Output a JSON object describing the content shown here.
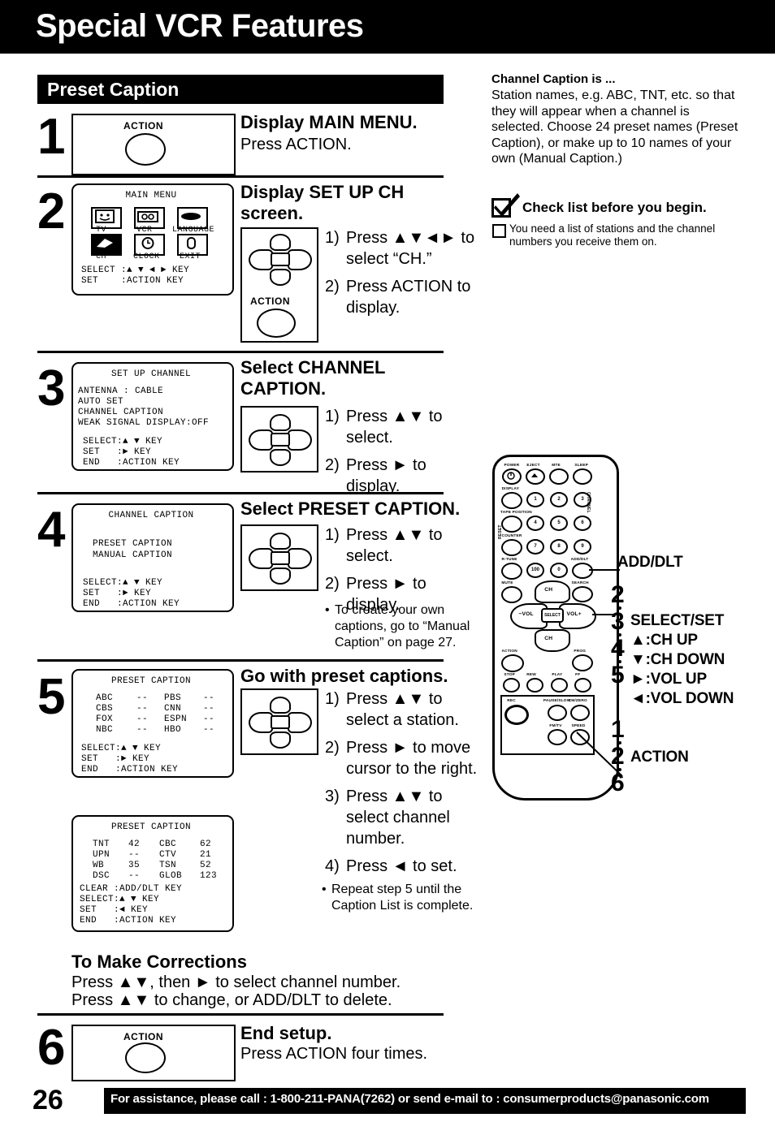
{
  "header": {
    "title": "Special VCR Features"
  },
  "section": {
    "bar_title": "Preset Caption"
  },
  "steps": [
    {
      "num": "1",
      "title": "Display MAIN MENU.",
      "body": "Press ACTION.",
      "action_label": "ACTION"
    },
    {
      "num": "2",
      "title_line1": "Display SET UP CH",
      "title_line2": "screen.",
      "action_label": "ACTION",
      "osd": {
        "title": "MAIN MENU",
        "icons": [
          {
            "label": "TV",
            "icon": "tv-icon",
            "selected": false
          },
          {
            "label": "VCR",
            "icon": "vcr-icon",
            "selected": false
          },
          {
            "label": "LANGUAGE",
            "icon": "language-icon",
            "selected": false
          },
          {
            "label": "CH",
            "icon": "ch-icon",
            "selected": true
          },
          {
            "label": "CLOCK",
            "icon": "clock-icon",
            "selected": false
          },
          {
            "label": "EXIT",
            "icon": "exit-icon",
            "selected": false
          }
        ],
        "footer": "SELECT :▲ ▼ ◄ ► KEY\nSET    :ACTION KEY"
      },
      "instructions": [
        {
          "n": "1)",
          "text": "Press ▲▼◄► to select “CH.”"
        },
        {
          "n": "2)",
          "text": "Press ACTION to display."
        }
      ]
    },
    {
      "num": "3",
      "title_line1": "Select CHANNEL",
      "title_line2": "CAPTION.",
      "osd": {
        "title": "SET UP CHANNEL",
        "lines": [
          {
            "text": "ANTENNA : CABLE",
            "hl": false
          },
          {
            "text": "AUTO SET",
            "hl": false
          },
          {
            "text": "CHANNEL CAPTION",
            "hl": true
          },
          {
            "text": "WEAK SIGNAL DISPLAY:OFF",
            "hl": false
          }
        ],
        "footer": "SELECT:▲ ▼ KEY\nSET   :► KEY\nEND   :ACTION KEY"
      },
      "instructions": [
        {
          "n": "1)",
          "text": "Press ▲▼ to select."
        },
        {
          "n": "2)",
          "text": "Press ► to display."
        }
      ]
    },
    {
      "num": "4",
      "title_line1": "Select PRESET CAPTION.",
      "osd": {
        "title": "CHANNEL CAPTION",
        "lines": [
          {
            "text": "PRESET CAPTION",
            "hl": true
          },
          {
            "text": "MANUAL CAPTION",
            "hl": false
          }
        ],
        "footer": "SELECT:▲ ▼ KEY\nSET   :► KEY\nEND   :ACTION KEY"
      },
      "instructions": [
        {
          "n": "1)",
          "text": "Press ▲▼ to select."
        },
        {
          "n": "2)",
          "text": "Press ► to display."
        }
      ],
      "note": "To create your own captions, go to “Manual Caption” on page 27."
    },
    {
      "num": "5",
      "title_line1": "Go with preset captions.",
      "osd1": {
        "title": "PRESET CAPTION",
        "rows": [
          {
            "c1": "ABC",
            "v1": "--",
            "c2": "PBS",
            "v2": "--",
            "hl1": true
          },
          {
            "c1": "CBS",
            "v1": "--",
            "c2": "CNN",
            "v2": "--",
            "hl1": false
          },
          {
            "c1": "FOX",
            "v1": "--",
            "c2": "ESPN",
            "v2": "--",
            "hl1": false
          },
          {
            "c1": "NBC",
            "v1": "--",
            "c2": "HBO",
            "v2": "--",
            "hl1": false
          }
        ],
        "footer": "SELECT:▲ ▼ KEY\nSET   :► KEY\nEND   :ACTION KEY"
      },
      "osd2": {
        "title": "PRESET CAPTION",
        "rows": [
          {
            "c1": "TNT",
            "v1": "42",
            "c2": "CBC",
            "v2": "62",
            "hl2": false
          },
          {
            "c1": "UPN",
            "v1": "--",
            "c2": "CTV",
            "v2": "21",
            "hl2": false
          },
          {
            "c1": "WB",
            "v1": "35",
            "c2": "TSN",
            "v2": "52",
            "hl2": false
          },
          {
            "c1": "DSC",
            "v1": "--",
            "c2": "GLOB",
            "v2": "123",
            "hl2": true
          }
        ],
        "footer": "CLEAR :ADD/DLT KEY\nSELECT:▲ ▼ KEY\nSET   :◄ KEY\nEND   :ACTION KEY"
      },
      "instructions": [
        {
          "n": "1)",
          "text": "Press ▲▼ to select a station."
        },
        {
          "n": "2)",
          "text": "Press ► to move cursor to the right."
        },
        {
          "n": "3)",
          "text": "Press ▲▼ to select channel number."
        },
        {
          "n": "4)",
          "text": "Press ◄ to set."
        }
      ],
      "note": "Repeat step 5 until the Caption List is complete."
    },
    {
      "num": "6",
      "title": "End setup.",
      "body": "Press ACTION four times.",
      "action_label": "ACTION"
    }
  ],
  "corrections": {
    "heading": "To Make Corrections",
    "line1": "Press ▲▼, then ► to select channel number.",
    "line2": "Press ▲▼ to change, or ADD/DLT to delete."
  },
  "sidebar": {
    "heading": "Channel Caption is ...",
    "paragraph": "Station names, e.g. ABC, TNT, etc. so that they will appear when a channel is selected. Choose 24 preset names (Preset Caption), or make up to 10 names of your own (Manual Caption.)",
    "check_heading": "Check list before you begin.",
    "check_item": "You need a list of stations and the channel numbers you receive them on."
  },
  "remote": {
    "buttons_row1": [
      "POWER",
      "EJECT",
      "MTE",
      "SLEEP"
    ],
    "left_column": [
      "DISPLAY",
      "TAPE POSITION",
      "COUNTER",
      "R-TUNE",
      "MUTE"
    ],
    "keypad": [
      "1",
      "2",
      "3",
      "4",
      "5",
      "6",
      "7",
      "8",
      "9",
      "100",
      "0"
    ],
    "add_dlt": "ADD/DLT",
    "search": "SEARCH",
    "vol_minus": "−VOL",
    "vol_plus": "VOL+",
    "select": "SELECT",
    "ch_up": "CH",
    "ch_down": "CH",
    "action": "ACTION",
    "prog": "PROG",
    "transport": [
      "STOP",
      "REW",
      "PLAY",
      "FF"
    ],
    "rec": "REC",
    "pause_slow": "PAUSE/SLOW",
    "cm_zero": "CM/ZERO",
    "fm_tv": "FM/TV",
    "speed": "SPEED",
    "channel_side": "CHANNEL",
    "reset": "RESET"
  },
  "callouts": {
    "add_dlt": "ADD/DLT",
    "select_set": "SELECT/SET",
    "ch_up": "▲:CH UP",
    "ch_down": "▼:CH DOWN",
    "vol_up": "►:VOL UP",
    "vol_down": "◄:VOL DOWN",
    "action": "ACTION",
    "nums_select": [
      "2",
      "3",
      "4",
      "5"
    ],
    "nums_action": [
      "1",
      "2",
      "6"
    ]
  },
  "footer": {
    "page_number": "26",
    "text": "For assistance, please call : 1-800-211-PANA(7262) or send e-mail to : consumerproducts@panasonic.com"
  }
}
